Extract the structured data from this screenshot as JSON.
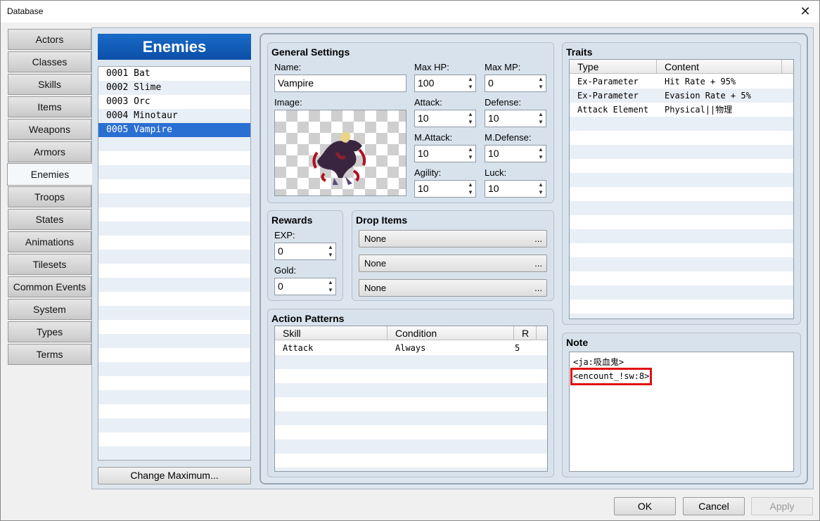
{
  "window": {
    "title": "Database",
    "close": "✕"
  },
  "categories": [
    "Actors",
    "Classes",
    "Skills",
    "Items",
    "Weapons",
    "Armors",
    "Enemies",
    "Troops",
    "States",
    "Animations",
    "Tilesets",
    "Common Events",
    "System",
    "Types",
    "Terms"
  ],
  "active_category": "Enemies",
  "enemies": {
    "header": "Enemies",
    "items": [
      "0001 Bat",
      "0002 Slime",
      "0003 Orc",
      "0004 Minotaur",
      "0005 Vampire"
    ],
    "selected": "0005 Vampire",
    "change_max": "Change Maximum..."
  },
  "general": {
    "title": "General Settings",
    "name_label": "Name:",
    "name_value": "Vampire",
    "image_label": "Image:",
    "max_hp_label": "Max HP:",
    "max_hp": "100",
    "max_mp_label": "Max MP:",
    "max_mp": "0",
    "attack_label": "Attack:",
    "attack": "10",
    "defense_label": "Defense:",
    "defense": "10",
    "matk_label": "M.Attack:",
    "matk": "10",
    "mdef_label": "M.Defense:",
    "mdef": "10",
    "agility_label": "Agility:",
    "agility": "10",
    "luck_label": "Luck:",
    "luck": "10"
  },
  "rewards": {
    "title": "Rewards",
    "exp_label": "EXP:",
    "exp": "0",
    "gold_label": "Gold:",
    "gold": "0"
  },
  "drops": {
    "title": "Drop Items",
    "items": [
      "None",
      "None",
      "None"
    ],
    "dots": "..."
  },
  "actions": {
    "title": "Action Patterns",
    "headers": [
      "Skill",
      "Condition",
      "R"
    ],
    "rows": [
      {
        "skill": "Attack",
        "condition": "Always",
        "r": "5"
      }
    ]
  },
  "traits": {
    "title": "Traits",
    "headers": [
      "Type",
      "Content"
    ],
    "rows": [
      {
        "type": "Ex-Parameter",
        "content": "Hit Rate + 95%"
      },
      {
        "type": "Ex-Parameter",
        "content": "Evasion Rate + 5%"
      },
      {
        "type": "Attack Element",
        "content": "Physical||物理"
      }
    ]
  },
  "note": {
    "title": "Note",
    "lines": [
      "<ja:吸血鬼>",
      "<encount_!sw:8>"
    ]
  },
  "footer": {
    "ok": "OK",
    "cancel": "Cancel",
    "apply": "Apply"
  },
  "colors": {
    "accent": "#0b4fa8",
    "selection": "#2a6fd2",
    "highlight": "#e01010"
  }
}
